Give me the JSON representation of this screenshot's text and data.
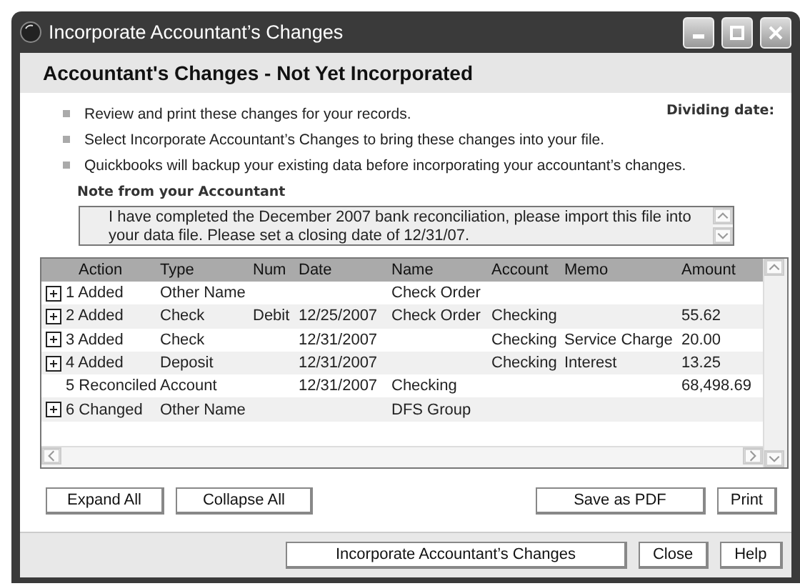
{
  "window": {
    "title": "Incorporate Accountant’s Changes"
  },
  "heading": "Accountant's Changes - Not Yet Incorporated",
  "instructions": [
    "Review and print these changes for your records.",
    "Select Incorporate Accountant’s Changes to bring these changes into your file.",
    "Quickbooks will backup your existing data before incorporating your accountant’s changes."
  ],
  "dividing_date_label": "Dividing date:",
  "note": {
    "label": "Note from your Accountant",
    "text": "I have completed the December 2007 bank reconciliation, please import this file into your data file. Please set a closing date of 12/31/07."
  },
  "table": {
    "columns": [
      "Action",
      "Type",
      "Num",
      "Date",
      "Name",
      "Account",
      "Memo",
      "Amount"
    ],
    "rows": [
      {
        "kind": "group",
        "cells": [
          "1 Added",
          "Other Name",
          "",
          "",
          "Check Order",
          "",
          "",
          ""
        ]
      },
      {
        "kind": "group",
        "cells": [
          "2 Added",
          "Check",
          "Debit",
          "12/25/2007",
          "Check Order",
          "Checking",
          "",
          "55.62"
        ]
      },
      {
        "kind": "group",
        "cells": [
          "3 Added",
          "Check",
          "",
          "12/31/2007",
          "",
          "Checking",
          "Service Charge",
          "20.00"
        ]
      },
      {
        "kind": "group",
        "cells": [
          "4 Added",
          "Deposit",
          "",
          "12/31/2007",
          "",
          "Checking",
          "Interest",
          "13.25"
        ]
      },
      {
        "kind": "item",
        "cells": [
          "5 Reconciled",
          "Account",
          "",
          "12/31/2007",
          "Checking",
          "",
          "",
          "68,498.69"
        ]
      },
      {
        "kind": "group",
        "cells": [
          "6 Changed",
          "Other Name",
          "",
          "",
          "DFS Group",
          "",
          "",
          ""
        ]
      }
    ]
  },
  "list_buttons": [
    "Expand All",
    "Collapse All"
  ],
  "output_buttons": [
    "Save as PDF",
    "Print"
  ],
  "footer_buttons": [
    "Incorporate Accountant’s Changes",
    "Close",
    "Help"
  ]
}
